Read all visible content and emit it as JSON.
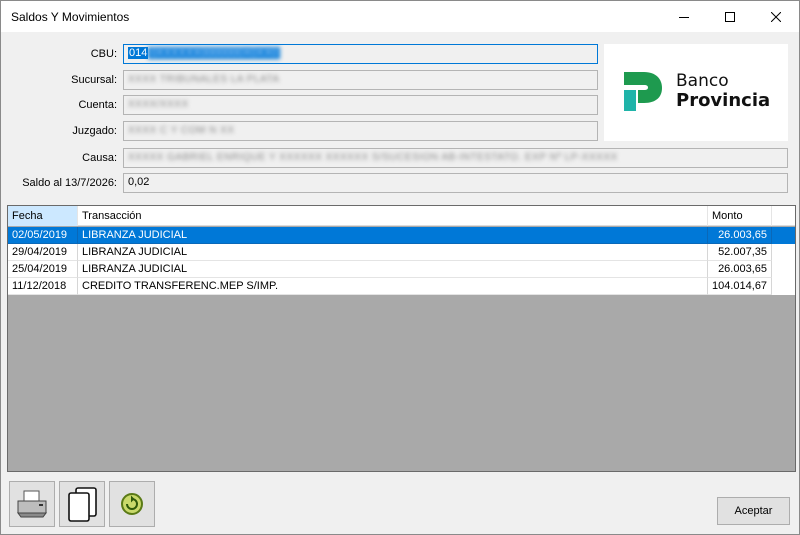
{
  "window": {
    "title": "Saldos Y Movimientos"
  },
  "fields": {
    "cbu": {
      "label": "CBU:",
      "value_prefix": "014",
      "value_masked": "0XXXXXX0000000X0XX0"
    },
    "sucursal": {
      "label": "Sucursal:",
      "value_masked": "XXXX TRIBUNALES LA PLATA"
    },
    "cuenta": {
      "label": "Cuenta:",
      "value_masked": "XXXX/XXXX"
    },
    "juzgado": {
      "label": "Juzgado:",
      "value_masked": "XXXX C Y COM N XX"
    },
    "causa": {
      "label": "Causa:",
      "value_masked": "XXXXX GABRIEL ENRIQUE Y XXXXXX XXXXXX S/SUCESION AB-INTESTATO. EXP Nº LP-XXXXX"
    },
    "saldo": {
      "label": "Saldo al 13/7/2026:",
      "value": "0,02"
    }
  },
  "brand": {
    "line1": "Banco",
    "line2": "Provincia",
    "colors": {
      "green": "#1e9a4f",
      "teal": "#1fb4a9"
    }
  },
  "grid": {
    "columns": {
      "fecha": "Fecha",
      "transaccion": "Transacción",
      "monto": "Monto"
    },
    "rows": [
      {
        "fecha": "02/05/2019",
        "transaccion": "LIBRANZA JUDICIAL",
        "monto": "26.003,65",
        "selected": true
      },
      {
        "fecha": "29/04/2019",
        "transaccion": "LIBRANZA JUDICIAL",
        "monto": "52.007,35",
        "selected": false
      },
      {
        "fecha": "25/04/2019",
        "transaccion": "LIBRANZA JUDICIAL",
        "monto": "26.003,65",
        "selected": false
      },
      {
        "fecha": "11/12/2018",
        "transaccion": "CREDITO TRANSFERENC.MEP S/IMP.",
        "monto": "104.014,67",
        "selected": false
      }
    ]
  },
  "toolbar": {
    "print_icon": "printer-icon",
    "copy_icon": "copy-pages-icon",
    "refresh_icon": "refresh-icon"
  },
  "buttons": {
    "accept": "Aceptar"
  }
}
